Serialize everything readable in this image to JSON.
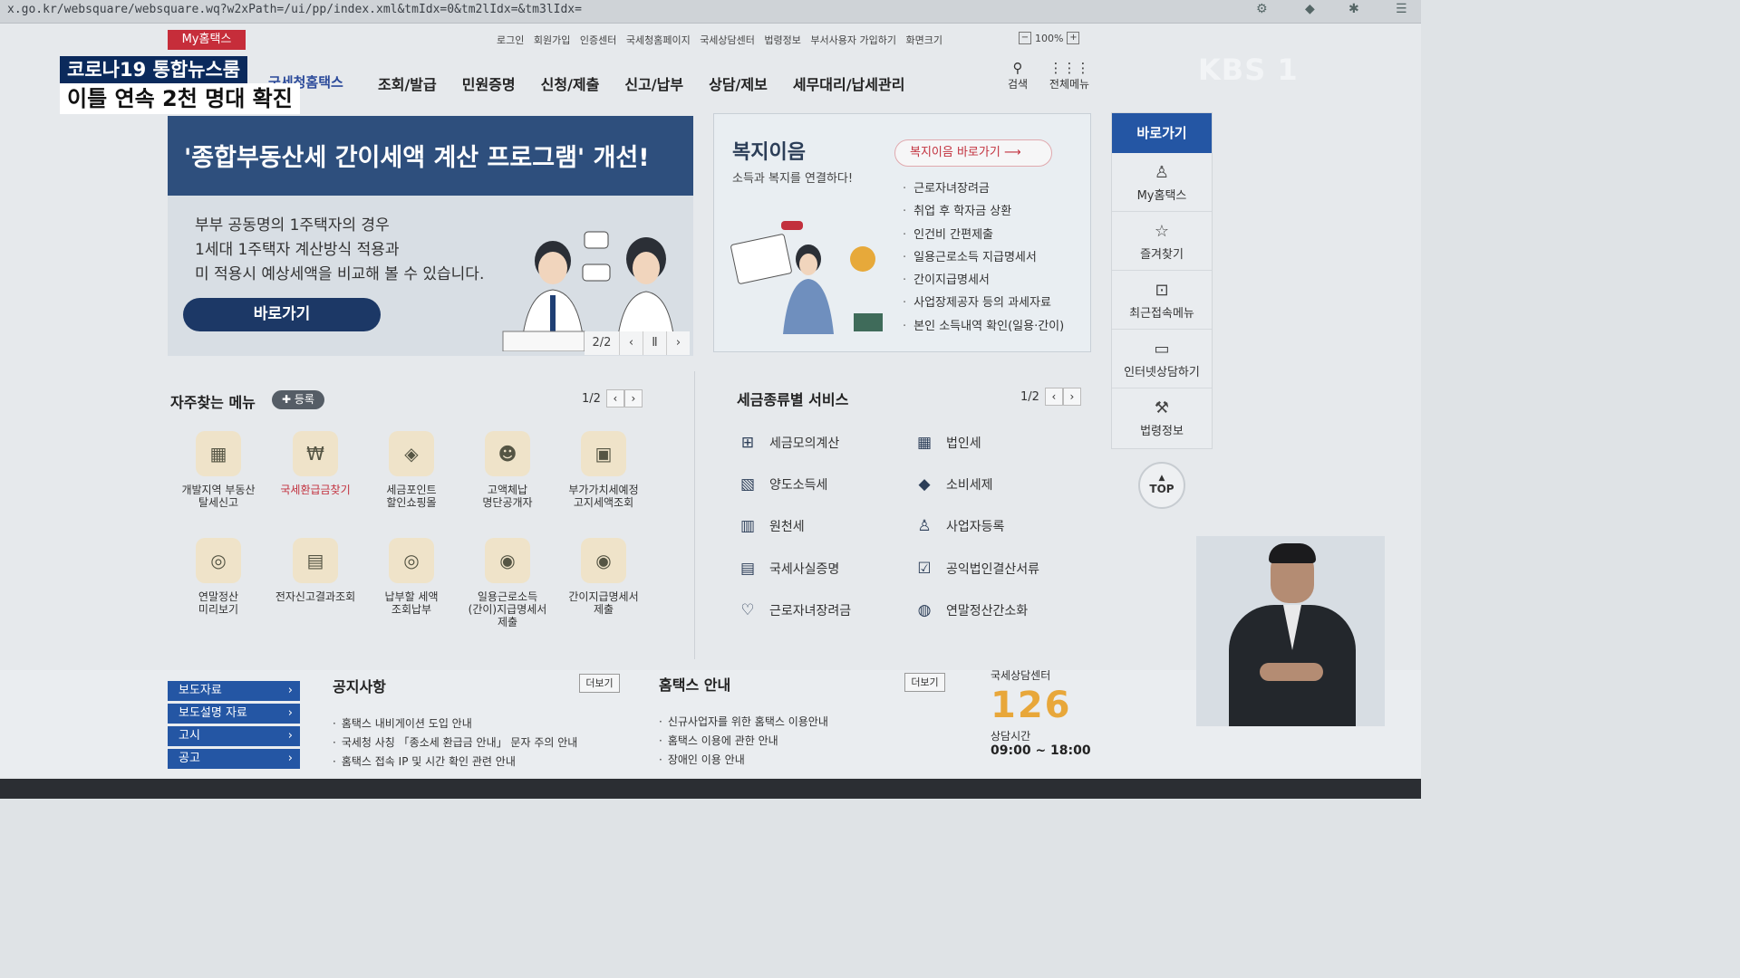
{
  "browser": {
    "url": "x.go.kr/websquare/websquare.wq?w2xPath=/ui/pp/index.xml&tmIdx=0&tm2lIdx=&tm3lIdx="
  },
  "header": {
    "my_hometax": "My홈택스",
    "util_links": [
      "로그인",
      "회원가입",
      "인증센터",
      "국세청홈페이지",
      "국세상담센터",
      "법령정보",
      "부서사용자 가입하기",
      "화면크기"
    ],
    "zoom": "100%",
    "logo_text": "국세청홈택스",
    "gnb": [
      "조회/발급",
      "민원증명",
      "신청/제출",
      "신고/납부",
      "상담/제보",
      "세무대리/납세관리"
    ],
    "search_label": "검색",
    "all_menu_label": "전체메뉴"
  },
  "broadcast": {
    "news_tag": "코로나19 통합뉴스룸",
    "headline": "이틀 연속 2천 명대 확진",
    "channel_logo": "KBS 1"
  },
  "banner": {
    "title": "'종합부동산세 간이세액 계산 프로그램' 개선!",
    "lines": [
      "부부 공동명의 1주택자의 경우",
      "1세대 1주택자 계산방식 적용과",
      "미 적용시 예상세액을 비교해 볼 수 있습니다."
    ],
    "button": "바로가기",
    "page": "2/2"
  },
  "welfare": {
    "title": "복지이음",
    "subtitle": "소득과 복지를 연결하다!",
    "link": "복지이음 바로가기",
    "items": [
      "근로자녀장려금",
      "취업 후 학자금 상환",
      "인건비 간편제출",
      "일용근로소득 지급명세서",
      "간이지급명세서",
      "사업장제공자 등의 과세자료",
      "본인 소득내역 확인(일용·간이)"
    ]
  },
  "quick": {
    "title": "바로가기",
    "items": [
      "My홈택스",
      "즐겨찾기",
      "최근접속메뉴",
      "인터넷상담하기",
      "법령정보"
    ],
    "top": "TOP"
  },
  "favorites": {
    "title": "자주찾는 메뉴",
    "register": "등록",
    "page": "1/2",
    "items": [
      {
        "l1": "개발지역 부동산",
        "l2": "탈세신고"
      },
      {
        "l1": "국세환급금찾기",
        "l2": ""
      },
      {
        "l1": "세금포인트",
        "l2": "할인쇼핑몰"
      },
      {
        "l1": "고액체납",
        "l2": "명단공개자"
      },
      {
        "l1": "부가가치세예정",
        "l2": "고지세액조회"
      },
      {
        "l1": "연말정산",
        "l2": "미리보기"
      },
      {
        "l1": "전자신고결과조회",
        "l2": ""
      },
      {
        "l1": "납부할 세액",
        "l2": "조회납부"
      },
      {
        "l1": "일용근로소득",
        "l2": "(간이)지급명세서",
        "l3": "제출"
      },
      {
        "l1": "간이지급명세서",
        "l2": "제출"
      }
    ]
  },
  "tax_services": {
    "title": "세금종류별 서비스",
    "page": "1/2",
    "left": [
      "세금모의계산",
      "양도소득세",
      "원천세",
      "국세사실증명",
      "근로자녀장려금"
    ],
    "right": [
      "법인세",
      "소비세제",
      "사업자등록",
      "공익법인결산서류",
      "연말정산간소화"
    ]
  },
  "bottom": {
    "side_nav": [
      "보도자료",
      "보도설명 자료",
      "고시",
      "공고"
    ],
    "notice_title": "공지사항",
    "notice_more": "더보기",
    "notices": [
      "홈택스 내비게이션 도입 안내",
      "국세청 사칭 「종소세 환급금 안내」 문자 주의 안내",
      "홈택스 접속 IP 및 시간 확인 관련 안내"
    ],
    "guide_title": "홈택스 안내",
    "guide_more": "더보기",
    "guides": [
      "신규사업자를 위한 홈택스 이용안내",
      "홈택스 이용에 관한 안내",
      "장애인 이용 안내"
    ],
    "center_title": "국세상담센터",
    "center_number": "126",
    "hours_label": "상담시간",
    "hours": "09:00 ~ 18:00"
  }
}
